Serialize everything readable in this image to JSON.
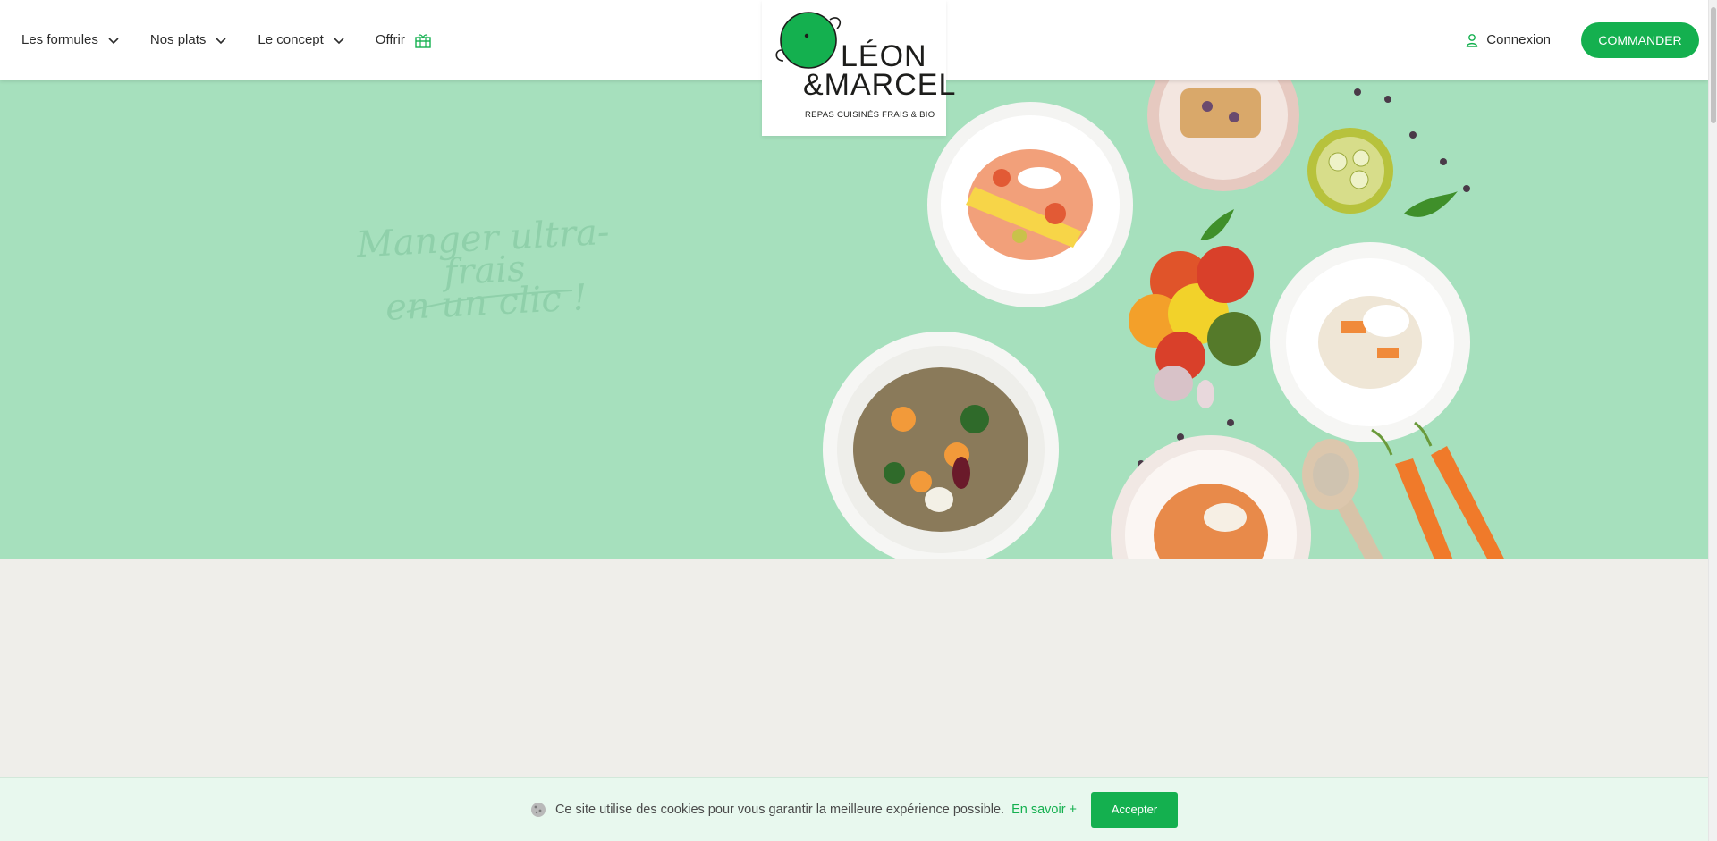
{
  "nav": {
    "items": [
      {
        "label": "Les formules",
        "icon": "chevron-down-icon"
      },
      {
        "label": "Nos plats",
        "icon": "chevron-down-icon"
      },
      {
        "label": "Le concept",
        "icon": "chevron-down-icon"
      },
      {
        "label": "Offrir",
        "icon": "gift-icon"
      }
    ]
  },
  "logo": {
    "line1": "LÉON",
    "line2": "&MARCEL",
    "tagline": "REPAS CUISINÉS FRAIS & BIO"
  },
  "actions": {
    "login_label": "Connexion",
    "order_label": "COMMANDER"
  },
  "hero": {
    "tagline_line1": "Manger ultra-frais",
    "tagline_line2": "en un clic !"
  },
  "cookie": {
    "text": "Ce site utilise des cookies pour vous garantir la meilleure expérience possible.",
    "more_label": "En savoir +",
    "accept_label": "Accepter"
  },
  "colors": {
    "brand_green": "#14b04f",
    "hero_bg": "#a6e0bd",
    "page_bg": "#efeeea",
    "cookie_bg": "#e8f8ee"
  }
}
